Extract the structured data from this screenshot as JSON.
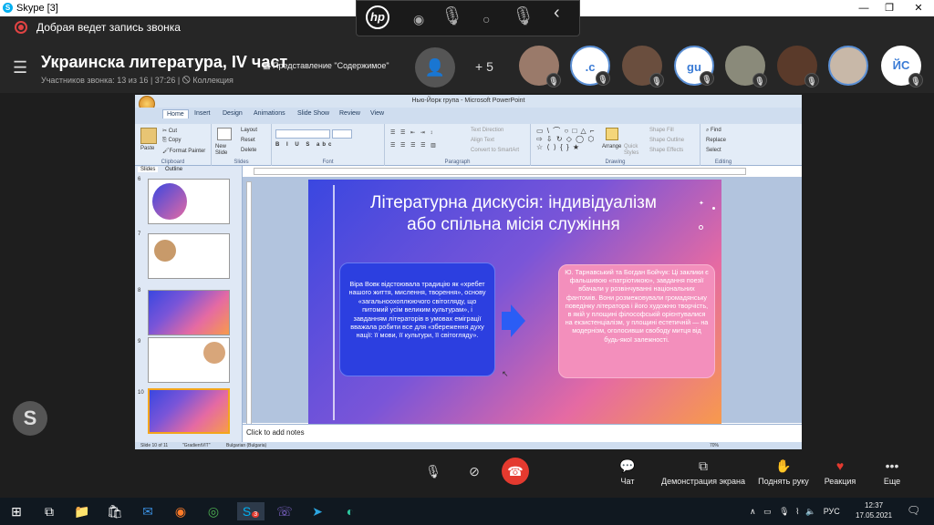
{
  "window": {
    "title": "Skype [3]"
  },
  "recording": {
    "text": "Добрая ведет запись звонка"
  },
  "call": {
    "title": "Украинска литература, IV част",
    "subtitle": "Участников звонка: 13 из 16 | 37:26 | 🛇 Коллекция",
    "share_label": "Представление \"Содержимое\"",
    "extra_count": "+ 5",
    "participants": [
      {
        "initials": "",
        "kind": "photo",
        "color": "#9a7a6a"
      },
      {
        "initials": ".c",
        "kind": "initials",
        "color": "#ffffff"
      },
      {
        "initials": "",
        "kind": "photo",
        "color": "#6a4e3e"
      },
      {
        "initials": "gu",
        "kind": "initials",
        "color": "#ffffff"
      },
      {
        "initials": "",
        "kind": "photo",
        "color": "#8a8a7a"
      },
      {
        "initials": "",
        "kind": "photo",
        "color": "#5a3a2a"
      },
      {
        "initials": "",
        "kind": "photo",
        "color": "#c8b8a8"
      },
      {
        "initials": "ЙС",
        "kind": "initials",
        "color": "#ffffff"
      }
    ]
  },
  "ppt": {
    "window_title": "Нью-Йорк група - Microsoft PowerPoint",
    "tabs": [
      "Home",
      "Insert",
      "Design",
      "Animations",
      "Slide Show",
      "Review",
      "View"
    ],
    "groups": {
      "clipboard": "Clipboard",
      "slides": "Slides",
      "font": "Font",
      "paragraph": "Paragraph",
      "drawing": "Drawing",
      "editing": "Editing"
    },
    "buttons": {
      "paste": "Paste",
      "cut": "Cut",
      "copy": "Copy",
      "format_painter": "Format Painter",
      "new_slide": "New Slide",
      "layout": "Layout",
      "reset": "Reset",
      "delete": "Delete",
      "text_direction": "Text Direction",
      "align_text": "Align Text",
      "convert_smartart": "Convert to SmartArt",
      "arrange": "Arrange",
      "quick_styles": "Quick Styles",
      "shape_fill": "Shape Fill",
      "shape_outline": "Shape Outline",
      "shape_effects": "Shape Effects",
      "find": "Find",
      "replace": "Replace",
      "select": "Select"
    },
    "panel_tabs": [
      "Slides",
      "Outline"
    ],
    "slide_numbers": [
      "6",
      "7",
      "8",
      "9",
      "10"
    ],
    "notes_placeholder": "Click to add notes",
    "status": {
      "slide": "Slide 10 of 11",
      "theme": "\"GradientVIT\"",
      "lang": "Bulgarian (Bulgaria)",
      "zoom": "70%"
    },
    "slide": {
      "title_line1": "Літературна дискусія: індивідуалізм",
      "title_line2": "або спільна місія служіння",
      "left_text": "Віра Вовк відстоювала традицію як «хребет нашого життя, мислення, творення», основу «загальноохоплюючого світогляду, що питомий усім великим культурам», і завданням літераторів в умовах еміграції вважала робити все для «збереження духу нації: її мови, її культури, її світогляду».",
      "right_text": "Ю. Тарнавський та Богдан Бойчук: Ці заклики є фальшивою «патріотикою», завдання поезії вбачали у розвінчуванні національних фантомів. Вони розмежовували громадянську поведінку літератора і його художню творчість, в якій у площині філософській орієнтувалися на екзистенціалізм, у площині естетичній — на модернізм, оголосивши свободу митця від будь-якої залежності."
    }
  },
  "controls": {
    "chat": "Чат",
    "screen_share": "Демонстрация экрана",
    "raise_hand": "Поднять руку",
    "reaction": "Реакция",
    "more": "Еще"
  },
  "taskbar": {
    "lang": "РУС",
    "time": "12:37",
    "date": "17.05.2021",
    "skype_badge": "3"
  }
}
